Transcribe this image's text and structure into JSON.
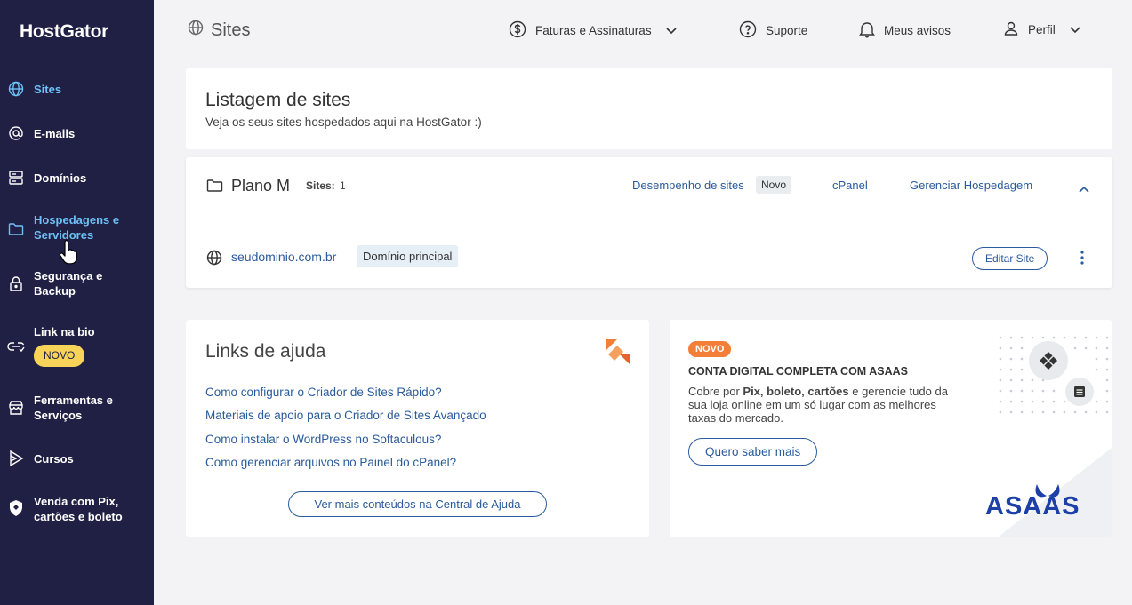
{
  "brand": {
    "logo": "HostGator"
  },
  "sidebar": {
    "items": [
      {
        "label": "Sites",
        "icon": "globe-icon"
      },
      {
        "label": "E-mails",
        "icon": "at-icon"
      },
      {
        "label": "Domínios",
        "icon": "server-icon"
      },
      {
        "label": "Hospedagens e Servidores",
        "icon": "folder-icon"
      },
      {
        "label": "Segurança e Backup",
        "icon": "lock-icon"
      },
      {
        "label": "Link na bio",
        "icon": "link-icon",
        "badge": "NOVO"
      },
      {
        "label": "Ferramentas e Serviços",
        "icon": "store-icon"
      },
      {
        "label": "Cursos",
        "icon": "play-icon"
      },
      {
        "label": "Venda com Pix, cartões e boleto",
        "icon": "shield-icon"
      }
    ]
  },
  "header": {
    "title": "Sites",
    "links": {
      "billing": "Faturas e Assinaturas",
      "support": "Suporte",
      "notices": "Meus avisos",
      "profile": "Perfil"
    }
  },
  "listing": {
    "title": "Listagem de sites",
    "subtitle": "Veja os seus sites hospedados aqui na HostGator :)"
  },
  "plan": {
    "name": "Plano M",
    "sites_label": "Sites:",
    "sites_count": "1",
    "performance_link": "Desempenho de sites",
    "performance_badge": "Novo",
    "cpanel_link": "cPanel",
    "manage_link": "Gerenciar Hospedagem",
    "site": {
      "domain": "seudominio.com.br",
      "badge": "Domínio principal",
      "edit_button": "Editar Site"
    }
  },
  "help": {
    "title": "Links de ajuda",
    "links": [
      "Como configurar o Criador de Sites Rápido?",
      "Materiais de apoio para o Criador de Sites Avançado",
      "Como instalar o WordPress no Softaculous?",
      "Como gerenciar arquivos no Painel do cPanel?"
    ],
    "more_button": "Ver mais conteúdos na Central de Ajuda"
  },
  "promo": {
    "badge": "NOVO",
    "title": "CONTA DIGITAL COMPLETA COM ASAAS",
    "text_prefix": "Cobre por ",
    "text_bold": "Pix, boleto, cartões",
    "text_suffix": " e gerencie tudo da sua loja online em um só lugar com as melhores taxas do mercado.",
    "button": "Quero saber mais",
    "brand_logo": "ASAAS"
  },
  "colors": {
    "sidebar_bg": "#1f2044",
    "accent": "#6ec1f5",
    "link": "#2a5b9c",
    "badge_yellow": "#f7d35a",
    "badge_orange": "#f27e38",
    "asaas_blue": "#1c3fa8"
  }
}
